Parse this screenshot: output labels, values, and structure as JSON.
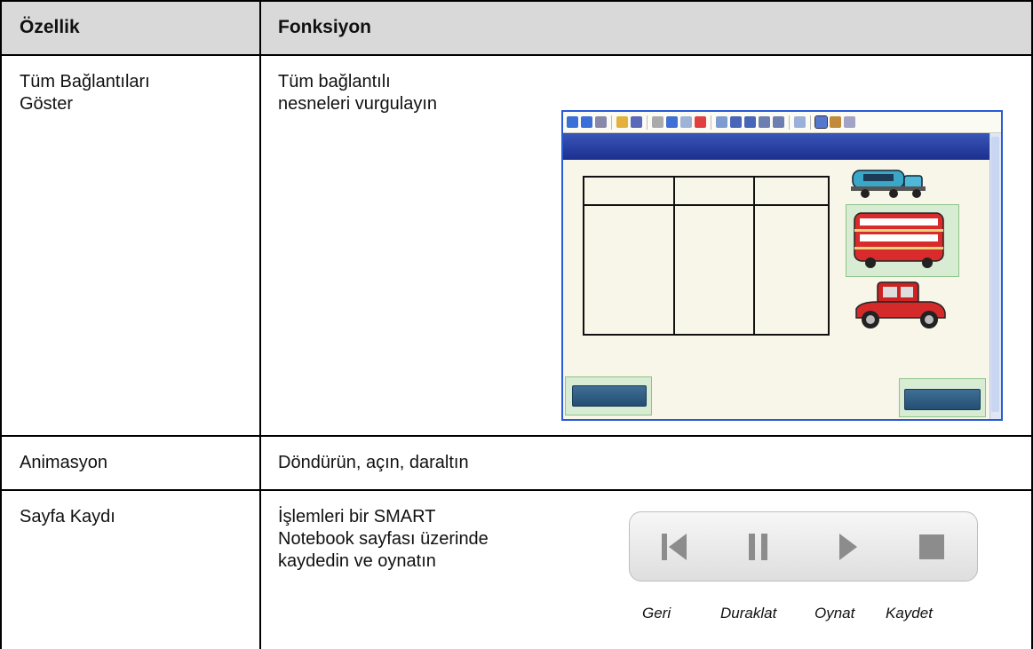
{
  "header": {
    "col1": "Özellik",
    "col2": "Fonksiyon"
  },
  "rows": [
    {
      "feature": [
        "Tüm Bağlantıları",
        "Göster"
      ],
      "function": [
        "Tüm bağlantılı",
        "nesneleri vurgulayın"
      ]
    },
    {
      "feature": [
        "Animasyon"
      ],
      "function": [
        "Döndürün, açın, daraltın"
      ]
    },
    {
      "feature": [
        "Sayfa Kaydı"
      ],
      "function": [
        "İşlemleri bir SMART",
        "Notebook sayfası üzerinde",
        "kaydedin ve oynatın"
      ]
    }
  ],
  "recorder": {
    "labels": {
      "back": "Geri",
      "pause": "Duraklat",
      "play": "Oynat",
      "record": "Kaydet"
    },
    "icons": [
      "rewind-icon",
      "pause-icon",
      "play-icon",
      "stop-icon"
    ]
  },
  "colors": {
    "header_bg": "#d9d9d9",
    "screenshot_border": "#2a5bd7",
    "title_band": "#1c2f8f"
  }
}
